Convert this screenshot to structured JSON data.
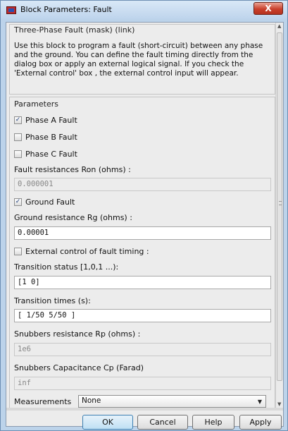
{
  "window": {
    "title": "Block Parameters: Fault",
    "close_label": "X"
  },
  "mask": {
    "title": "Three-Phase Fault (mask) (link)",
    "description": "Use this block to program a fault (short-circuit) between any phase and the ground. You can define the fault timing directly from the dialog box or apply an external logical signal. If you check the 'External control' box , the external control input will appear."
  },
  "parameters": {
    "title": "Parameters",
    "phase_a": {
      "label": "Phase A Fault",
      "checked": true
    },
    "phase_b": {
      "label": "Phase B Fault",
      "checked": false
    },
    "phase_c": {
      "label": "Phase C Fault",
      "checked": false
    },
    "fault_resistance": {
      "label": "Fault resistances  Ron (ohms) :",
      "value": "0.000001"
    },
    "ground_fault": {
      "label": "Ground Fault",
      "checked": true
    },
    "ground_resistance": {
      "label": "Ground resistance Rg (ohms) :",
      "value": "0.00001"
    },
    "external_control": {
      "label": "External control of fault timing :",
      "checked": false
    },
    "transition_status": {
      "label": "Transition status [1,0,1 ...):",
      "value": "[1 0]"
    },
    "transition_times": {
      "label": "Transition times (s):",
      "value": "[ 1/50 5/50 ]"
    },
    "snubbers_resistance": {
      "label": "Snubbers resistance Rp (ohms) :",
      "value": "1e6"
    },
    "snubbers_capacitance": {
      "label": "Snubbers Capacitance Cp (Farad)",
      "value": "inf"
    },
    "measurements": {
      "label": "Measurements",
      "value": "None"
    }
  },
  "buttons": {
    "ok": "OK",
    "cancel": "Cancel",
    "help": "Help",
    "apply": "Apply"
  },
  "icons": {
    "check": "✓",
    "dropdown": "▼",
    "scroll_up": "▲",
    "scroll_down": "▼"
  }
}
